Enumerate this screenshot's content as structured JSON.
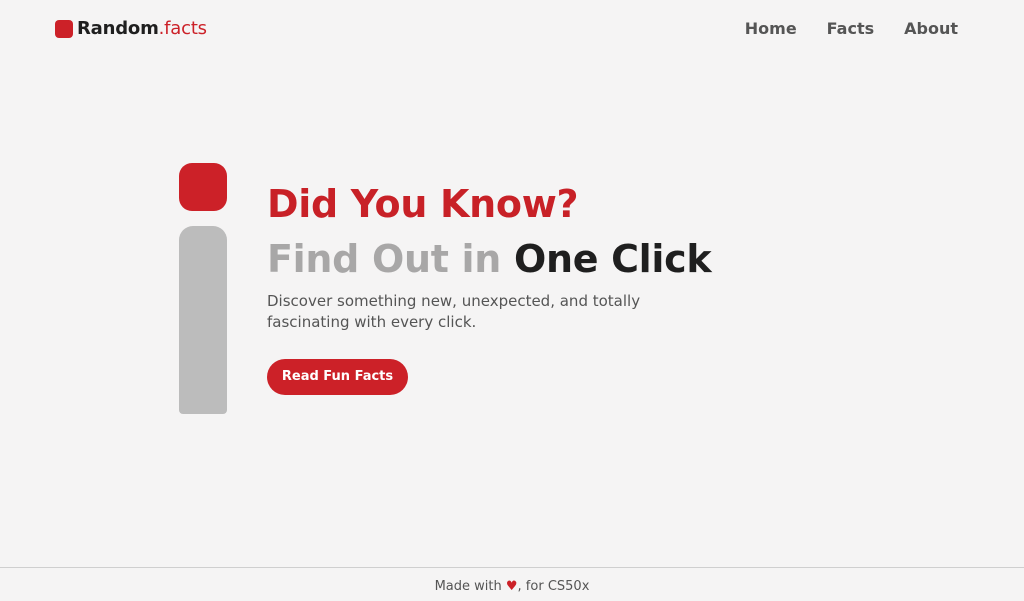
{
  "header": {
    "logo_bold": "Random",
    "logo_accent": ".facts",
    "nav": [
      "Home",
      "Facts",
      "About"
    ]
  },
  "hero": {
    "title": "Did You Know?",
    "subtitle_light": "Find Out in",
    "subtitle_dark": "One Click",
    "description": "Discover something new, unexpected, and totally fascinating with every click.",
    "cta_label": "Read Fun Facts"
  },
  "footer": {
    "prefix": "Made with",
    "heart": "♥",
    "suffix": ", for CS50x"
  },
  "colors": {
    "accent": "#cc2128",
    "dark_text": "#1f1f1f",
    "muted_text": "#555555",
    "light_gray": "#bcbcbc",
    "background": "#f5f4f4"
  }
}
